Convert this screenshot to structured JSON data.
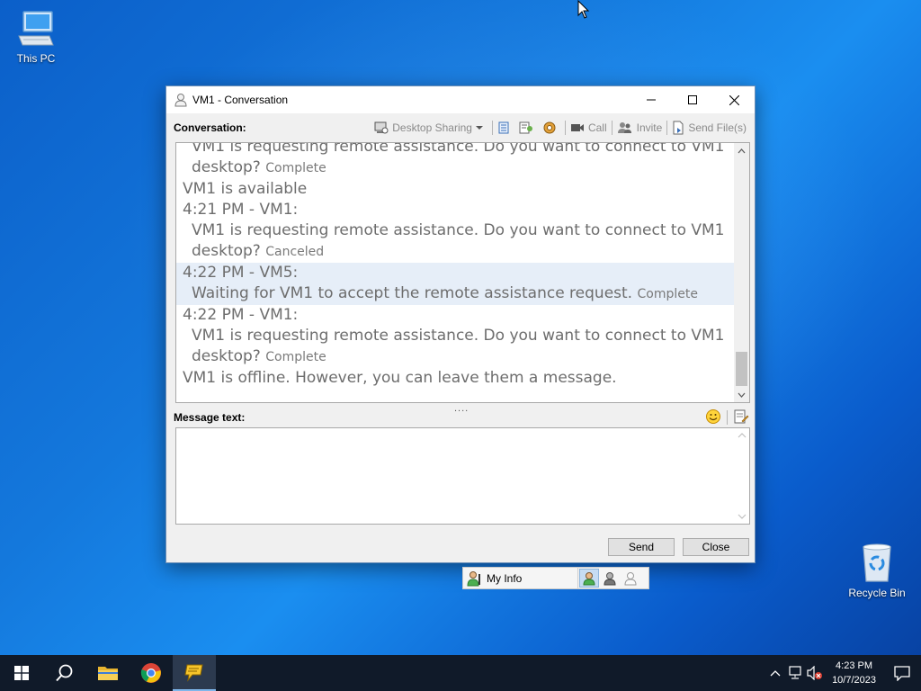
{
  "desktop": {
    "icons": [
      {
        "label": "This PC"
      },
      {
        "label": "Recycle Bin"
      }
    ]
  },
  "window": {
    "title": "VM1 - Conversation",
    "conversation_label": "Conversation:",
    "toolbar": {
      "desktop_sharing": "Desktop Sharing",
      "call": "Call",
      "invite": "Invite",
      "send_files": "Send File(s)"
    },
    "messages": [
      {
        "text": "VM1 is requesting remote assistance. Do you want to connect to VM1",
        "indent": true
      },
      {
        "text": "desktop?",
        "status": "Complete",
        "indent": true
      },
      {
        "text": "VM1 is available",
        "indent": false
      },
      {
        "text": "4:21 PM - VM1:",
        "indent": false
      },
      {
        "text": "VM1 is requesting remote assistance. Do you want to connect to VM1",
        "indent": true
      },
      {
        "text": "desktop?",
        "status": "Canceled",
        "indent": true
      },
      {
        "text": "4:22 PM - VM5:",
        "indent": false
      },
      {
        "text": "Waiting for VM1 to accept the remote assistance request.",
        "status": "Complete",
        "indent": true
      },
      {
        "text": "4:22 PM - VM1:",
        "indent": false
      },
      {
        "text": "VM1 is requesting remote assistance. Do you want to connect to VM1",
        "indent": true
      },
      {
        "text": "desktop?",
        "status": "Complete",
        "indent": true
      },
      {
        "text": "VM1 is offline. However, you can leave them a message.",
        "indent": false
      }
    ],
    "splitter": "....",
    "message_text_label": "Message text:",
    "message_input_value": "",
    "send_label": "Send",
    "close_label": "Close"
  },
  "myinfo": {
    "label": "My Info"
  },
  "taskbar": {
    "time": "4:23 PM",
    "date": "10/7/2023"
  },
  "colors": {
    "taskbar_bg": "#101a29",
    "highlight_row": "#e6eef8"
  }
}
